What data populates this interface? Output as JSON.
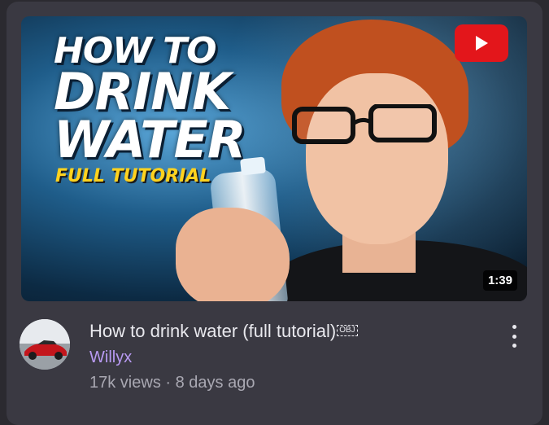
{
  "thumbnail": {
    "title_line1": "HOW TO",
    "title_line2": "DRINK",
    "title_line3": "WATER",
    "subtitle": "FULL TUTORIAL",
    "duration": "1:39",
    "logo_icon": "youtube-play-logo-icon"
  },
  "video": {
    "title": "How to drink water (full tutorial)",
    "title_glyph": "OBJ",
    "channel": "Willyx",
    "views": "17k views",
    "separator": "·",
    "age": "8 days ago",
    "more_icon": "more-vert-icon"
  },
  "colors": {
    "background": "#2b2a30",
    "card": "#3a3942",
    "channel_text": "#b89af2",
    "subtitle_yellow": "#ffd21e",
    "logo_red": "#e3161b"
  }
}
